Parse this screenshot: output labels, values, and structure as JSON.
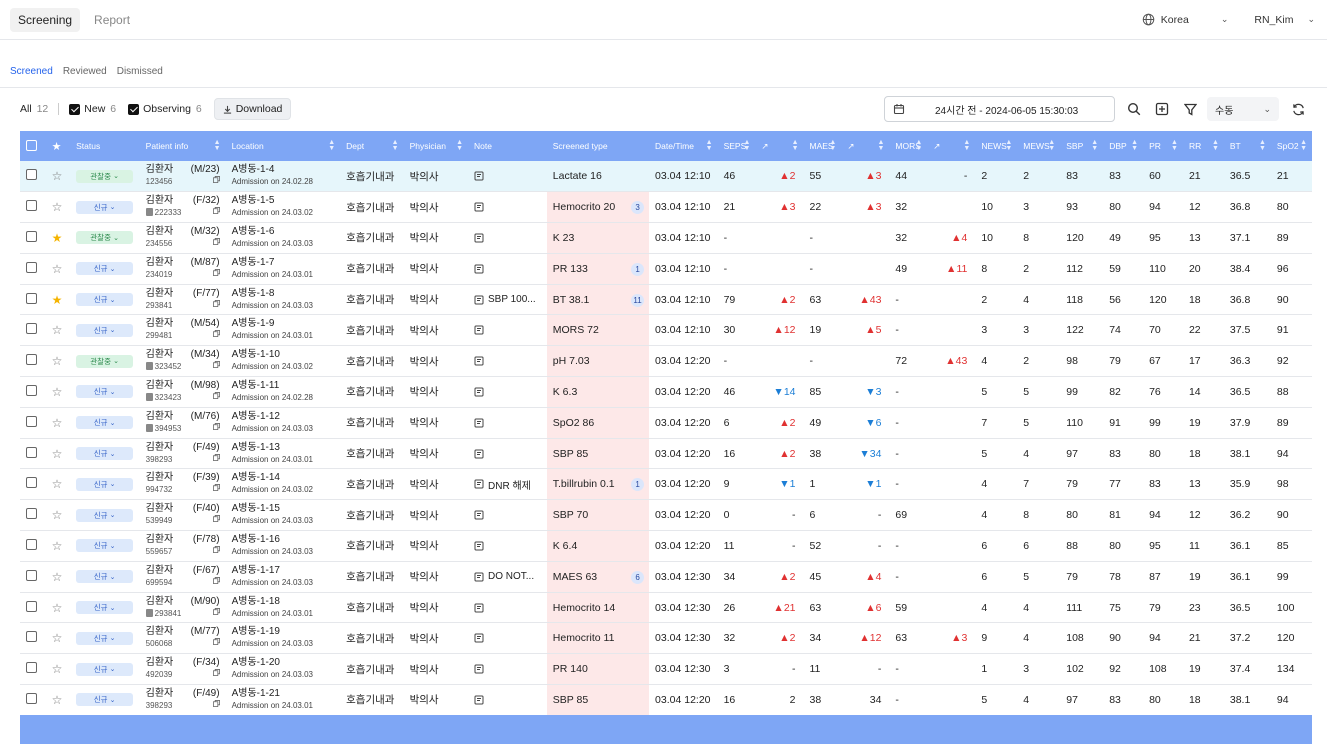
{
  "nav": {
    "tabs": [
      "Screening",
      "Report"
    ],
    "country": "Korea",
    "user": "RN_Kim"
  },
  "subtabs": [
    "Screened",
    "Reviewed",
    "Dismissed"
  ],
  "toolbar": {
    "all_label": "All",
    "all_count": "12",
    "new_label": "New",
    "new_count": "6",
    "observing_label": "Observing",
    "observing_count": "6",
    "download_label": "Download",
    "date_range": "24시간 전 - 2024-06-05 15:30:03",
    "mode": "수동"
  },
  "columns": [
    "Status",
    "Patient info",
    "Location",
    "Dept",
    "Physician",
    "Note",
    "Screened type",
    "Date/Time",
    "SEPS",
    "MAES",
    "MORS",
    "NEWS",
    "MEWS",
    "SBP",
    "DBP",
    "PR",
    "RR",
    "BT",
    "SpO2"
  ],
  "rows": [
    {
      "starred": false,
      "status": "관찰중",
      "status_type": "obs",
      "name": "김환자",
      "sexage": "(M/23)",
      "id": "123456",
      "idbadge": false,
      "loc": "A병동-1-4",
      "adm": "Admission on 24.02.28",
      "dept": "호흡기내과",
      "phys": "박의사",
      "note": "",
      "stype": "Lactate 16",
      "stcount": "",
      "dt": "03.04 12:10",
      "seps": "46",
      "seps_tr": "▲2",
      "maes": "55",
      "maes_tr": "▲3",
      "mors": "44",
      "mors_tr": "-",
      "news": "2",
      "mews": "2",
      "sbp": "83",
      "dbp": "83",
      "pr": "60",
      "rr": "21",
      "bt": "36.5",
      "spo2": "21",
      "hl": true
    },
    {
      "starred": false,
      "status": "신규",
      "status_type": "new",
      "name": "김환자",
      "sexage": "(F/32)",
      "id": "222333",
      "idbadge": true,
      "loc": "A병동-1-5",
      "adm": "Admission on 24.03.02",
      "dept": "호흡기내과",
      "phys": "박의사",
      "note": "",
      "stype": "Hemocrito 20",
      "stcount": "3",
      "dt": "03.04 12:10",
      "seps": "21",
      "seps_tr": "▲3",
      "maes": "22",
      "maes_tr": "▲3",
      "mors": "32",
      "mors_tr": "",
      "news": "10",
      "mews": "3",
      "sbp": "93",
      "dbp": "80",
      "pr": "94",
      "rr": "12",
      "bt": "36.8",
      "spo2": "80",
      "hl": false
    },
    {
      "starred": true,
      "status": "관찰중",
      "status_type": "obs",
      "name": "김환자",
      "sexage": "(M/32)",
      "id": "234556",
      "idbadge": false,
      "loc": "A병동-1-6",
      "adm": "Admission on 24.03.03",
      "dept": "호흡기내과",
      "phys": "박의사",
      "note": "",
      "stype": "K 23",
      "stcount": "",
      "dt": "03.04 12:10",
      "seps": "-",
      "seps_tr": "",
      "maes": "-",
      "maes_tr": "",
      "mors": "32",
      "mors_tr": "▲4",
      "news": "10",
      "mews": "8",
      "sbp": "120",
      "dbp": "49",
      "pr": "95",
      "rr": "13",
      "bt": "37.1",
      "spo2": "89",
      "hl": false
    },
    {
      "starred": false,
      "status": "신규",
      "status_type": "new",
      "name": "김환자",
      "sexage": "(M/87)",
      "id": "234019",
      "idbadge": false,
      "loc": "A병동-1-7",
      "adm": "Admission on 24.03.01",
      "dept": "호흡기내과",
      "phys": "박의사",
      "note": "",
      "stype": "PR 133",
      "stcount": "1",
      "dt": "03.04 12:10",
      "seps": "-",
      "seps_tr": "",
      "maes": "-",
      "maes_tr": "",
      "mors": "49",
      "mors_tr": "▲11",
      "news": "8",
      "mews": "2",
      "sbp": "112",
      "dbp": "59",
      "pr": "110",
      "rr": "20",
      "bt": "38.4",
      "spo2": "96",
      "hl": false
    },
    {
      "starred": true,
      "status": "신규",
      "status_type": "new",
      "name": "김환자",
      "sexage": "(F/77)",
      "id": "293841",
      "idbadge": false,
      "loc": "A병동-1-8",
      "adm": "Admission on 24.03.03",
      "dept": "호흡기내과",
      "phys": "박의사",
      "note": "SBP 100...",
      "stype": "BT 38.1",
      "stcount": "11",
      "dt": "03.04 12:10",
      "seps": "79",
      "seps_tr": "▲2",
      "maes": "63",
      "maes_tr": "▲43",
      "mors": "-",
      "mors_tr": "",
      "news": "2",
      "mews": "4",
      "sbp": "118",
      "dbp": "56",
      "pr": "120",
      "rr": "18",
      "bt": "36.8",
      "spo2": "90",
      "hl": false
    },
    {
      "starred": false,
      "status": "신규",
      "status_type": "new",
      "name": "김환자",
      "sexage": "(M/54)",
      "id": "299481",
      "idbadge": false,
      "loc": "A병동-1-9",
      "adm": "Admission on 24.03.01",
      "dept": "호흡기내과",
      "phys": "박의사",
      "note": "",
      "stype": "MORS 72",
      "stcount": "",
      "dt": "03.04 12:10",
      "seps": "30",
      "seps_tr": "▲12",
      "maes": "19",
      "maes_tr": "▲5",
      "mors": "-",
      "mors_tr": "",
      "news": "3",
      "mews": "3",
      "sbp": "122",
      "dbp": "74",
      "pr": "70",
      "rr": "22",
      "bt": "37.5",
      "spo2": "91",
      "hl": false
    },
    {
      "starred": false,
      "status": "관찰중",
      "status_type": "obs",
      "name": "김환자",
      "sexage": "(M/34)",
      "id": "323452",
      "idbadge": true,
      "loc": "A병동-1-10",
      "adm": "Admission on 24.03.02",
      "dept": "호흡기내과",
      "phys": "박의사",
      "note": "",
      "stype": "pH 7.03",
      "stcount": "",
      "dt": "03.04 12:20",
      "seps": "-",
      "seps_tr": "",
      "maes": "-",
      "maes_tr": "",
      "mors": "72",
      "mors_tr": "▲43",
      "news": "4",
      "mews": "2",
      "sbp": "98",
      "dbp": "79",
      "pr": "67",
      "rr": "17",
      "bt": "36.3",
      "spo2": "92",
      "hl": false
    },
    {
      "starred": false,
      "status": "신규",
      "status_type": "new",
      "name": "김환자",
      "sexage": "(M/98)",
      "id": "323423",
      "idbadge": true,
      "loc": "A병동-1-11",
      "adm": "Admission on 24.02.28",
      "dept": "호흡기내과",
      "phys": "박의사",
      "note": "",
      "stype": "K 6.3",
      "stcount": "",
      "dt": "03.04 12:20",
      "seps": "46",
      "seps_tr": "▼14",
      "maes": "85",
      "maes_tr": "▼3",
      "mors": "-",
      "mors_tr": "",
      "news": "5",
      "mews": "5",
      "sbp": "99",
      "dbp": "82",
      "pr": "76",
      "rr": "14",
      "bt": "36.5",
      "spo2": "88",
      "hl": false
    },
    {
      "starred": false,
      "status": "신규",
      "status_type": "new",
      "name": "김환자",
      "sexage": "(M/76)",
      "id": "394953",
      "idbadge": true,
      "loc": "A병동-1-12",
      "adm": "Admission on 24.03.03",
      "dept": "호흡기내과",
      "phys": "박의사",
      "note": "",
      "stype": "SpO2 86",
      "stcount": "",
      "dt": "03.04 12:20",
      "seps": "6",
      "seps_tr": "▲2",
      "maes": "49",
      "maes_tr": "▼6",
      "mors": "-",
      "mors_tr": "",
      "news": "7",
      "mews": "5",
      "sbp": "110",
      "dbp": "91",
      "pr": "99",
      "rr": "19",
      "bt": "37.9",
      "spo2": "89",
      "hl": false
    },
    {
      "starred": false,
      "status": "신규",
      "status_type": "new",
      "name": "김환자",
      "sexage": "(F/49)",
      "id": "398293",
      "idbadge": false,
      "loc": "A병동-1-13",
      "adm": "Admission on 24.03.01",
      "dept": "호흡기내과",
      "phys": "박의사",
      "note": "",
      "stype": "SBP 85",
      "stcount": "",
      "dt": "03.04 12:20",
      "seps": "16",
      "seps_tr": "▲2",
      "maes": "38",
      "maes_tr": "▼34",
      "mors": "-",
      "mors_tr": "",
      "news": "5",
      "mews": "4",
      "sbp": "97",
      "dbp": "83",
      "pr": "80",
      "rr": "18",
      "bt": "38.1",
      "spo2": "94",
      "hl": false
    },
    {
      "starred": false,
      "status": "신규",
      "status_type": "new",
      "name": "김환자",
      "sexage": "(F/39)",
      "id": "994732",
      "idbadge": false,
      "loc": "A병동-1-14",
      "adm": "Admission on 24.03.02",
      "dept": "호흡기내과",
      "phys": "박의사",
      "note": "DNR 해제",
      "stype": "T.billrubin 0.1",
      "stcount": "1",
      "dt": "03.04 12:20",
      "seps": "9",
      "seps_tr": "▼1",
      "maes": "1",
      "maes_tr": "▼1",
      "mors": "-",
      "mors_tr": "",
      "news": "4",
      "mews": "7",
      "sbp": "79",
      "dbp": "77",
      "pr": "83",
      "rr": "13",
      "bt": "35.9",
      "spo2": "98",
      "hl": false
    },
    {
      "starred": false,
      "status": "신규",
      "status_type": "new",
      "name": "김환자",
      "sexage": "(F/40)",
      "id": "539949",
      "idbadge": false,
      "loc": "A병동-1-15",
      "adm": "Admission on 24.03.03",
      "dept": "호흡기내과",
      "phys": "박의사",
      "note": "",
      "stype": "SBP 70",
      "stcount": "",
      "dt": "03.04 12:20",
      "seps": "0",
      "seps_tr": "-",
      "maes": "6",
      "maes_tr": "-",
      "mors": "69",
      "mors_tr": "",
      "news": "4",
      "mews": "8",
      "sbp": "80",
      "dbp": "81",
      "pr": "94",
      "rr": "12",
      "bt": "36.2",
      "spo2": "90",
      "hl": false
    },
    {
      "starred": false,
      "status": "신규",
      "status_type": "new",
      "name": "김환자",
      "sexage": "(F/78)",
      "id": "559657",
      "idbadge": false,
      "loc": "A병동-1-16",
      "adm": "Admission on 24.03.03",
      "dept": "호흡기내과",
      "phys": "박의사",
      "note": "",
      "stype": "K 6.4",
      "stcount": "",
      "dt": "03.04 12:20",
      "seps": "11",
      "seps_tr": "-",
      "maes": "52",
      "maes_tr": "-",
      "mors": "-",
      "mors_tr": "",
      "news": "6",
      "mews": "6",
      "sbp": "88",
      "dbp": "80",
      "pr": "95",
      "rr": "11",
      "bt": "36.1",
      "spo2": "85",
      "hl": false
    },
    {
      "starred": false,
      "status": "신규",
      "status_type": "new",
      "name": "김환자",
      "sexage": "(F/67)",
      "id": "699594",
      "idbadge": false,
      "loc": "A병동-1-17",
      "adm": "Admission on 24.03.03",
      "dept": "호흡기내과",
      "phys": "박의사",
      "note": "DO NOT...",
      "stype": "MAES 63",
      "stcount": "6",
      "dt": "03.04 12:30",
      "seps": "34",
      "seps_tr": "▲2",
      "maes": "45",
      "maes_tr": "▲4",
      "mors": "-",
      "mors_tr": "",
      "news": "6",
      "mews": "5",
      "sbp": "79",
      "dbp": "78",
      "pr": "87",
      "rr": "19",
      "bt": "36.1",
      "spo2": "99",
      "hl": false
    },
    {
      "starred": false,
      "status": "신규",
      "status_type": "new",
      "name": "김환자",
      "sexage": "(M/90)",
      "id": "293841",
      "idbadge": true,
      "loc": "A병동-1-18",
      "adm": "Admission on 24.03.01",
      "dept": "호흡기내과",
      "phys": "박의사",
      "note": "",
      "stype": "Hemocrito 14",
      "stcount": "",
      "dt": "03.04 12:30",
      "seps": "26",
      "seps_tr": "▲21",
      "maes": "63",
      "maes_tr": "▲6",
      "mors": "59",
      "mors_tr": "",
      "news": "4",
      "mews": "4",
      "sbp": "111",
      "dbp": "75",
      "pr": "79",
      "rr": "23",
      "bt": "36.5",
      "spo2": "100",
      "hl": false
    },
    {
      "starred": false,
      "status": "신규",
      "status_type": "new",
      "name": "김환자",
      "sexage": "(M/77)",
      "id": "506068",
      "idbadge": false,
      "loc": "A병동-1-19",
      "adm": "Admission on 24.03.03",
      "dept": "호흡기내과",
      "phys": "박의사",
      "note": "",
      "stype": "Hemocrito 11",
      "stcount": "",
      "dt": "03.04 12:30",
      "seps": "32",
      "seps_tr": "▲2",
      "maes": "34",
      "maes_tr": "▲12",
      "mors": "63",
      "mors_tr": "▲3",
      "news": "9",
      "mews": "4",
      "sbp": "108",
      "dbp": "90",
      "pr": "94",
      "rr": "21",
      "bt": "37.2",
      "spo2": "120",
      "hl": false
    },
    {
      "starred": false,
      "status": "신규",
      "status_type": "new",
      "name": "김환자",
      "sexage": "(F/34)",
      "id": "492039",
      "idbadge": false,
      "loc": "A병동-1-20",
      "adm": "Admission on 24.03.03",
      "dept": "호흡기내과",
      "phys": "박의사",
      "note": "",
      "stype": "PR 140",
      "stcount": "",
      "dt": "03.04 12:30",
      "seps": "3",
      "seps_tr": "-",
      "maes": "11",
      "maes_tr": "-",
      "mors": "-",
      "mors_tr": "",
      "news": "1",
      "mews": "3",
      "sbp": "102",
      "dbp": "92",
      "pr": "108",
      "rr": "19",
      "bt": "37.4",
      "spo2": "134",
      "hl": false
    },
    {
      "starred": false,
      "status": "신규",
      "status_type": "new",
      "name": "김환자",
      "sexage": "(F/49)",
      "id": "398293",
      "idbadge": false,
      "loc": "A병동-1-21",
      "adm": "Admission on 24.03.01",
      "dept": "호흡기내과",
      "phys": "박의사",
      "note": "",
      "stype": "SBP 85",
      "stcount": "",
      "dt": "03.04 12:20",
      "seps": "16",
      "seps_tr": "2",
      "maes": "38",
      "maes_tr": "34",
      "mors": "-",
      "mors_tr": "",
      "news": "5",
      "mews": "4",
      "sbp": "97",
      "dbp": "83",
      "pr": "80",
      "rr": "18",
      "bt": "38.1",
      "spo2": "94",
      "hl": false
    }
  ]
}
